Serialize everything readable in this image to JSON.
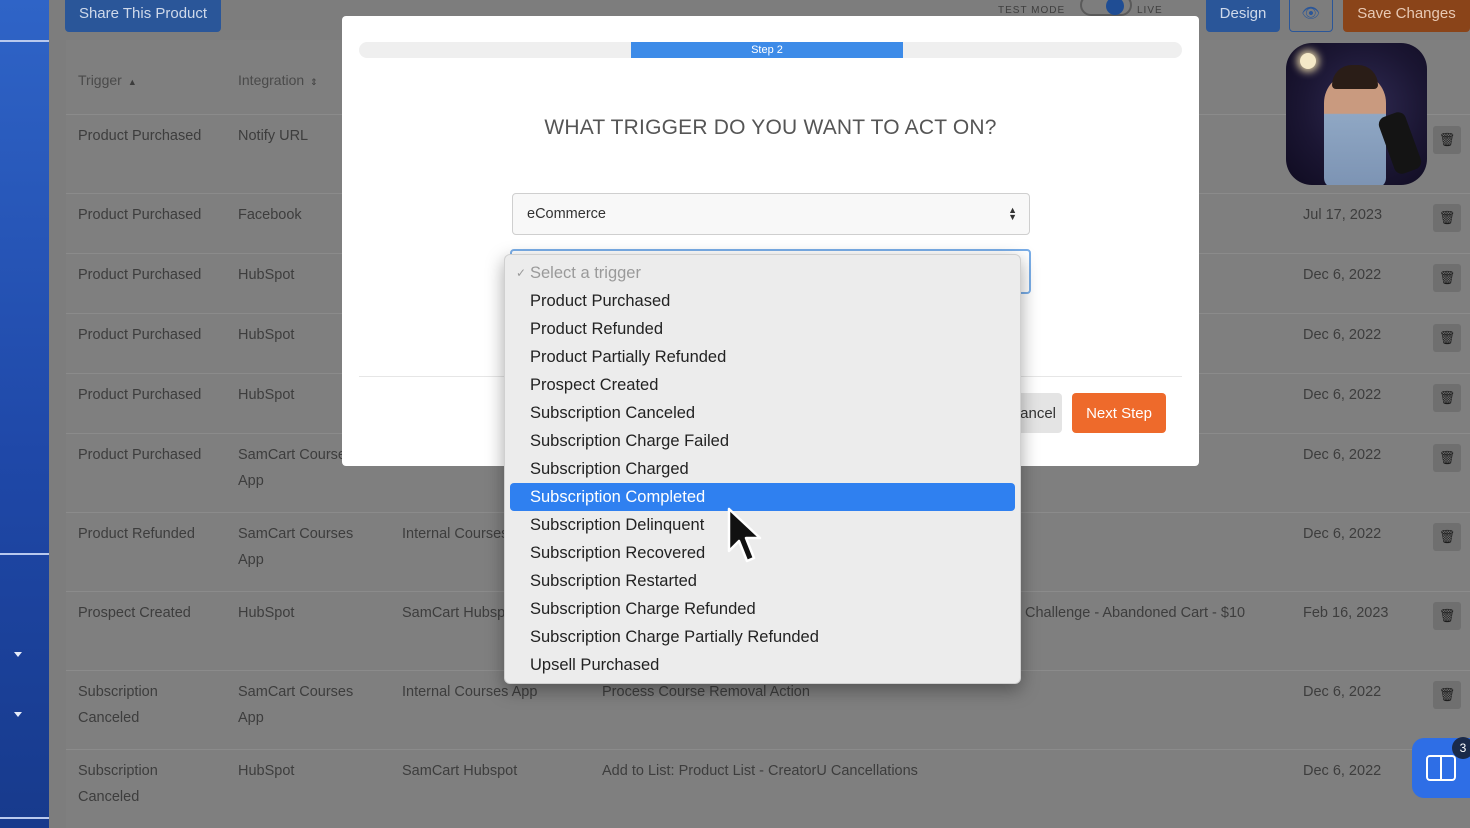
{
  "toolbar": {
    "share_label": "Share This Product",
    "test_mode_label": "TEST MODE",
    "live_label": "LIVE",
    "design_label": "Design",
    "save_label": "Save Changes"
  },
  "table": {
    "columns": {
      "trigger": "Trigger",
      "integration": "Integration"
    },
    "rows": [
      {
        "trigger": "Product Purchased",
        "integration": "Notify URL",
        "app": "",
        "action": "",
        "action_extra": "",
        "date": ""
      },
      {
        "trigger": "Product Purchased",
        "integration": "Facebook",
        "app": "",
        "action": "",
        "action_extra": "",
        "date": "Jul 17, 2023"
      },
      {
        "trigger": "Product Purchased",
        "integration": "HubSpot",
        "app": "",
        "action": "",
        "action_extra": "",
        "date": "Dec 6, 2022"
      },
      {
        "trigger": "Product Purchased",
        "integration": "HubSpot",
        "app": "",
        "action": "",
        "action_extra": "",
        "date": "Dec 6, 2022"
      },
      {
        "trigger": "Product Purchased",
        "integration": "HubSpot",
        "app": "",
        "action": "",
        "action_extra": "",
        "date": "Dec 6, 2022"
      },
      {
        "trigger": "Product Purchased",
        "integration": "SamCart Courses App",
        "app": "",
        "action": "",
        "action_extra": "",
        "date": "Dec 6, 2022"
      },
      {
        "trigger": "Product Refunded",
        "integration": "SamCart Courses App",
        "app": "Internal Courses App",
        "action": "",
        "action_extra": "",
        "date": "Dec 6, 2022"
      },
      {
        "trigger": "Prospect Created",
        "integration": "HubSpot",
        "app": "SamCart Hubspot",
        "action": "",
        "action_extra": "Challenge - Abandoned Cart - $10",
        "date": "Feb 16, 2023"
      },
      {
        "trigger": "Subscription Canceled",
        "integration": "SamCart Courses App",
        "app": "Internal Courses App",
        "action": "Process Course Removal Action",
        "action_extra": "",
        "date": "Dec 6, 2022"
      },
      {
        "trigger": "Subscription Canceled",
        "integration": "HubSpot",
        "app": "SamCart Hubspot",
        "action": "Add to List: Product List - CreatorU Cancellations",
        "action_extra": "",
        "date": "Dec 6, 2022"
      }
    ]
  },
  "modal": {
    "step_label": "Step 2",
    "step_progress_fraction": 0.33,
    "title": "WHAT TRIGGER DO YOU WANT TO ACT ON?",
    "category_value": "eCommerce",
    "cancel_label": "Cancel",
    "next_label": "Next Step"
  },
  "dropdown": {
    "placeholder": "Select a trigger",
    "selected_index": 7,
    "options": [
      "Product Purchased",
      "Product Refunded",
      "Product Partially Refunded",
      "Prospect Created",
      "Subscription Canceled",
      "Subscription Charge Failed",
      "Subscription Charged",
      "Subscription Completed",
      "Subscription Delinquent",
      "Subscription Recovered",
      "Subscription Restarted",
      "Subscription Charge Refunded",
      "Subscription Charge Partially Refunded",
      "Upsell Purchased"
    ]
  },
  "help": {
    "badge_count": "3",
    "icon": "book-open-icon"
  },
  "colors": {
    "primary_blue": "#2f80f0",
    "accent_orange": "#ee6a2b",
    "progress_blue": "#3d8be8"
  }
}
